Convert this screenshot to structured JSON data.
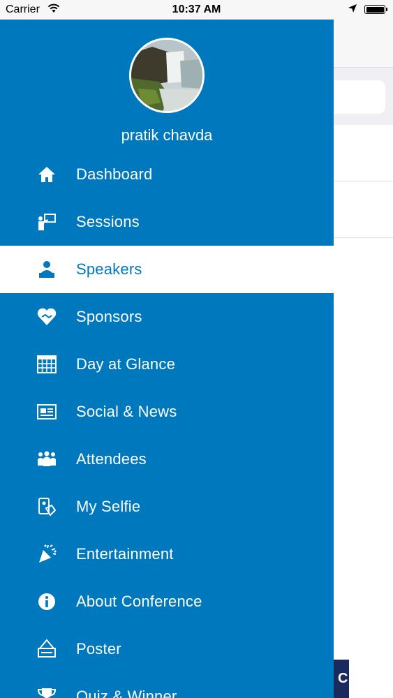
{
  "status_bar": {
    "carrier": "Carrier",
    "time": "10:37 AM"
  },
  "drawer": {
    "user_name": "pratik chavda",
    "active_item": "Speakers",
    "items": [
      {
        "label": "Dashboard",
        "icon": "home-icon"
      },
      {
        "label": "Sessions",
        "icon": "presentation-icon"
      },
      {
        "label": "Speakers",
        "icon": "speaker-icon"
      },
      {
        "label": "Sponsors",
        "icon": "handshake-heart-icon"
      },
      {
        "label": "Day at Glance",
        "icon": "calendar-grid-icon"
      },
      {
        "label": "Social & News",
        "icon": "newspaper-icon"
      },
      {
        "label": "Attendees",
        "icon": "group-icon"
      },
      {
        "label": "My Selfie",
        "icon": "phone-selfie-icon"
      },
      {
        "label": "Entertainment",
        "icon": "party-popper-icon"
      },
      {
        "label": "About Conference",
        "icon": "info-icon"
      },
      {
        "label": "Poster",
        "icon": "poster-icon"
      },
      {
        "label": "Quiz & Winner",
        "icon": "trophy-icon"
      }
    ]
  },
  "background_screen": {
    "button_text": "C"
  },
  "colors": {
    "drawer_bg": "#0078bd",
    "active_bg": "#ffffff",
    "active_text": "#0078bd",
    "text": "#ffffff"
  }
}
